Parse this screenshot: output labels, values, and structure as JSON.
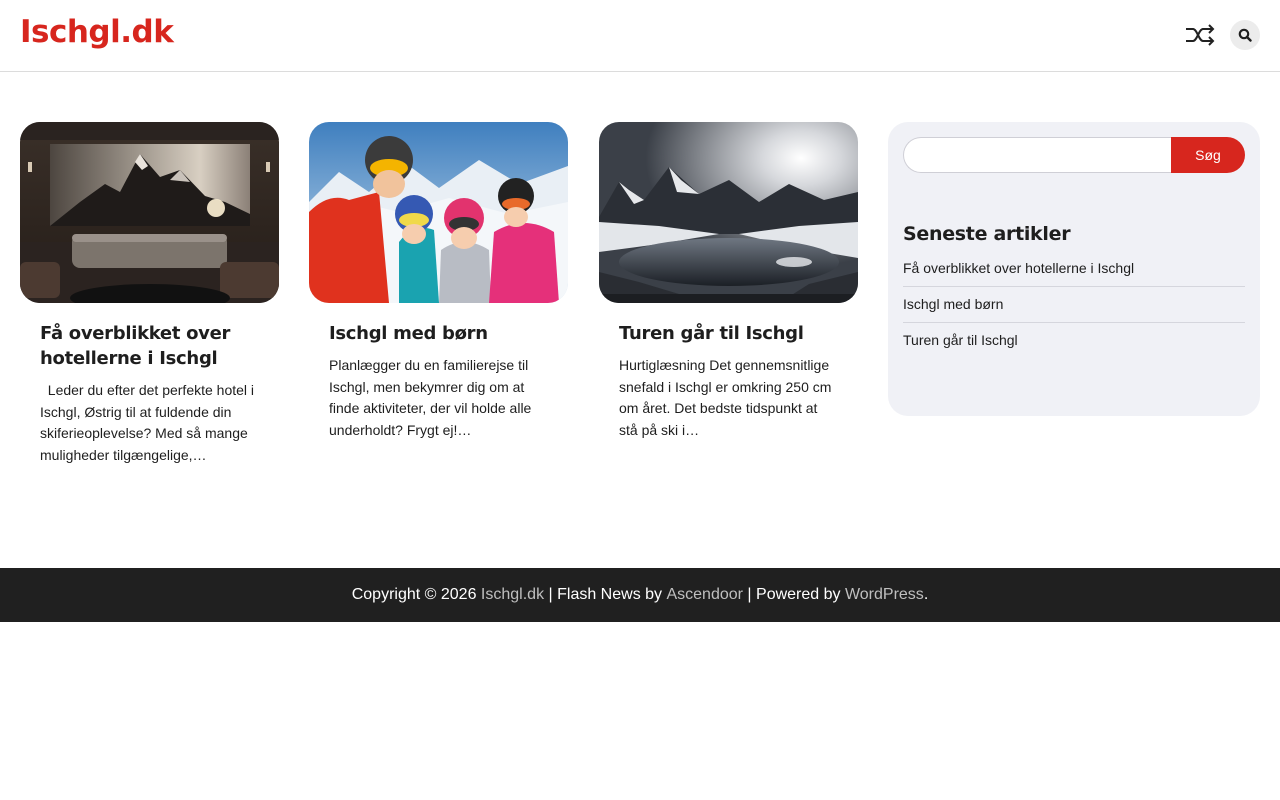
{
  "header": {
    "site_title": "Ischgl.dk",
    "shuffle_icon": "shuffle-icon",
    "search_icon": "search-icon"
  },
  "posts": [
    {
      "title": "Få overblikket over hotellerne i Ischgl",
      "excerpt": "  Leder du efter det perfekte hotel i Ischgl, Østrig til at fuldende din skiferieoplevelse? Med så mange muligheder tilgængelige,…",
      "image": "hotel-lobby-mountain-mural"
    },
    {
      "title": "Ischgl med børn",
      "excerpt": "Planlægger du en familierejse til Ischgl, men bekymrer dig om at finde aktiviteter, der vil holde alle underholdt? Frygt ej!…",
      "image": "family-skiing-selfie"
    },
    {
      "title": "Turen går til Ischgl",
      "excerpt": "Hurtiglæsning Det gennemsnitlige snefald i Ischgl er omkring 250 cm om året. Det bedste tidspunkt at stå på ski i…",
      "image": "snowy-mountain-lake"
    }
  ],
  "sidebar": {
    "search_value": "",
    "search_button": "Søg",
    "recent_title": "Seneste artikler",
    "recent": [
      "Få overblikket over hotellerne i Ischgl",
      "Ischgl med børn",
      "Turen går til Ischgl"
    ]
  },
  "footer": {
    "copyright": "Copyright © 2026 ",
    "site_link": "Ischgl.dk",
    "sep1": " | Flash News by ",
    "theme_link": "Ascendoor",
    "sep2": " | Powered by ",
    "wp_link": "WordPress",
    "end": "."
  },
  "colors": {
    "accent": "#d7261e",
    "footer_bg": "#202020",
    "sidebar_bg": "#f0f1f6"
  }
}
